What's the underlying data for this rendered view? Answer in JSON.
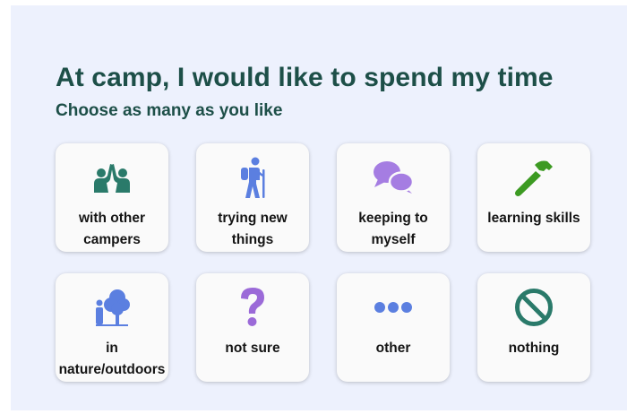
{
  "question": {
    "title": "At camp, I would like to spend my time",
    "subtitle": "Choose as many as you like"
  },
  "options": [
    {
      "label": "with other\ncampers",
      "icon": "high-five-people-icon",
      "color": "#2a7a6a"
    },
    {
      "label": "trying new\nthings",
      "icon": "hiker-icon",
      "color": "#5b7fe0"
    },
    {
      "label": "keeping to\nmyself",
      "icon": "speech-bubbles-icon",
      "color": "#a57de2"
    },
    {
      "label": "learning skills",
      "icon": "hammer-icon",
      "color": "#3c9a22"
    },
    {
      "label": "in\nnature/outdoors",
      "icon": "person-tree-icon",
      "color": "#5b7fe0"
    },
    {
      "label": "not sure",
      "icon": "question-mark-icon",
      "color": "#9b6ad8"
    },
    {
      "label": "other",
      "icon": "ellipsis-icon",
      "color": "#5b7fe0"
    },
    {
      "label": "nothing",
      "icon": "prohibited-icon",
      "color": "#2a7a6a"
    }
  ],
  "colors": {
    "heading": "#1d4f48",
    "panel_bg": "#edf1fd",
    "tile_bg": "#fafafa"
  }
}
